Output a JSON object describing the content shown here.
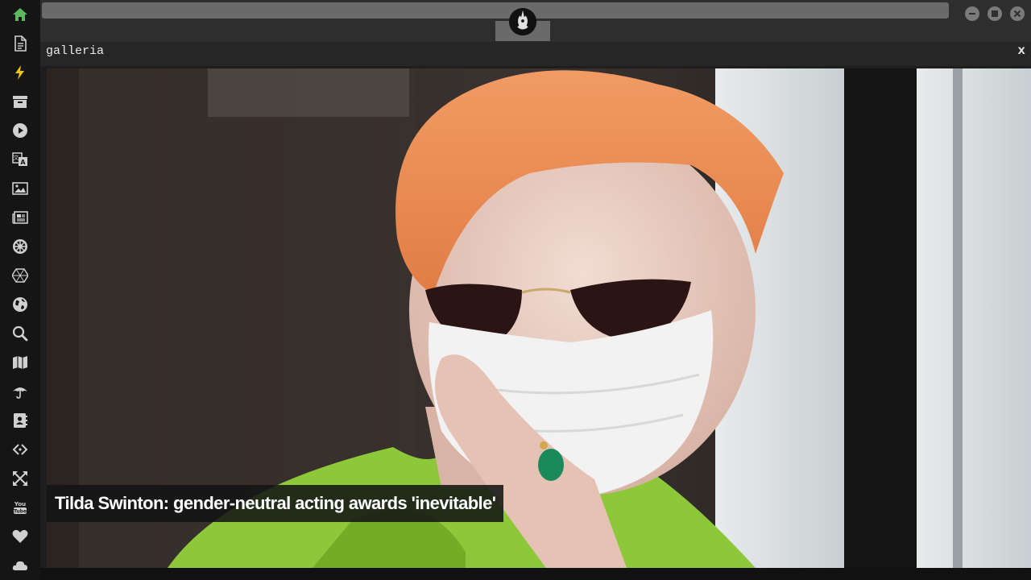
{
  "panel": {
    "title": "galleria",
    "close_label": "x"
  },
  "gallery": {
    "caption": "Tilda Swinton: gender-neutral acting awards 'inevitable'"
  },
  "sidebar": {
    "items": [
      {
        "icon": "home-icon",
        "color": "#5cb85c"
      },
      {
        "icon": "document-icon",
        "color": "#d0d0d0"
      },
      {
        "icon": "lightning-icon",
        "color": "#f0c419"
      },
      {
        "icon": "archive-icon",
        "color": "#d0d0d0"
      },
      {
        "icon": "play-icon",
        "color": "#d0d0d0"
      },
      {
        "icon": "translate-icon",
        "color": "#d0d0d0"
      },
      {
        "icon": "image-icon",
        "color": "#d0d0d0"
      },
      {
        "icon": "newspaper-icon",
        "color": "#d0d0d0"
      },
      {
        "icon": "galactic-empire-icon",
        "color": "#d0d0d0"
      },
      {
        "icon": "hexagon-icon",
        "color": "#d0d0d0"
      },
      {
        "icon": "globe-icon",
        "color": "#d0d0d0"
      },
      {
        "icon": "search-icon",
        "color": "#d0d0d0"
      },
      {
        "icon": "map-icon",
        "color": "#d0d0d0"
      },
      {
        "icon": "umbrella-icon",
        "color": "#d0d0d0"
      },
      {
        "icon": "contacts-icon",
        "color": "#d0d0d0"
      },
      {
        "icon": "code-icon",
        "color": "#d0d0d0"
      },
      {
        "icon": "expand-icon",
        "color": "#d0d0d0"
      },
      {
        "icon": "youtube-icon",
        "color": "#d0d0d0"
      },
      {
        "icon": "heart-icon",
        "color": "#d0d0d0"
      },
      {
        "icon": "cloud-icon",
        "color": "#d0d0d0"
      }
    ]
  },
  "window_controls": [
    "minimize-icon",
    "maximize-icon",
    "close-icon"
  ],
  "colors": {
    "accent_home": "#5cb85c",
    "accent_lightning": "#f0c419",
    "sidebar_bg": "#151515",
    "panel_bg": "#262626"
  }
}
